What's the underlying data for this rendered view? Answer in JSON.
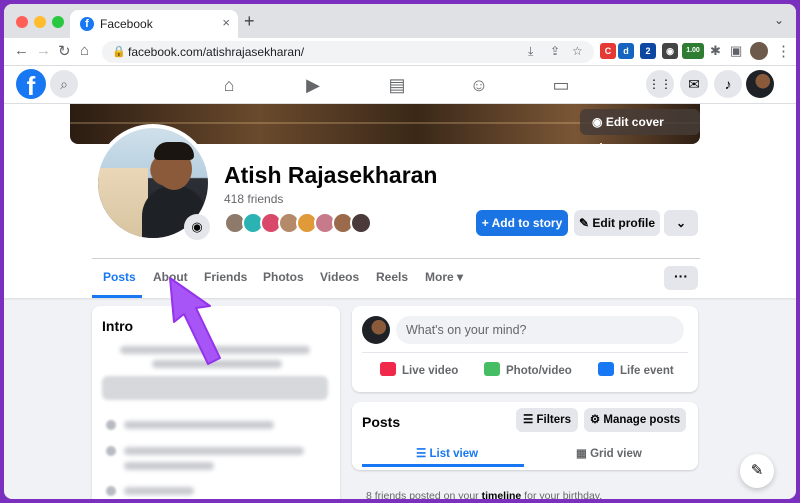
{
  "browser": {
    "tab_title": "Facebook",
    "tab_close": "×",
    "new_tab": "+",
    "tab_menu": "⌄",
    "url": "facebook.com/atishrajasekharan/",
    "extension_badge": "1.00",
    "extension_badge_small": "2"
  },
  "fb_nav": {
    "logo": "f"
  },
  "profile": {
    "edit_cover": "Edit cover photo",
    "name": "Atish Rajasekharan",
    "friends": "418 friends",
    "add_story": "+ Add to story",
    "edit_profile": "Edit profile",
    "tabs": [
      {
        "label": "Posts"
      },
      {
        "label": "About"
      },
      {
        "label": "Friends"
      },
      {
        "label": "Photos"
      },
      {
        "label": "Videos"
      },
      {
        "label": "Reels"
      },
      {
        "label": "More ▾"
      }
    ],
    "more_dots": "···"
  },
  "intro": {
    "title": "Intro"
  },
  "composer": {
    "placeholder": "What's on your mind?",
    "actions": [
      {
        "label": "Live video"
      },
      {
        "label": "Photo/video"
      },
      {
        "label": "Life event"
      }
    ]
  },
  "posts": {
    "title": "Posts",
    "filters": "Filters",
    "manage": "Manage posts",
    "list_view": "List view",
    "grid_view": "Grid view",
    "bday_prefix": "8 friends posted on your ",
    "bday_link": "timeline",
    "bday_suffix": " for your birthday."
  },
  "colors": {
    "accent": "#1877f2",
    "background_frame": "#7b2fbf",
    "arrow": "#a855f7"
  }
}
